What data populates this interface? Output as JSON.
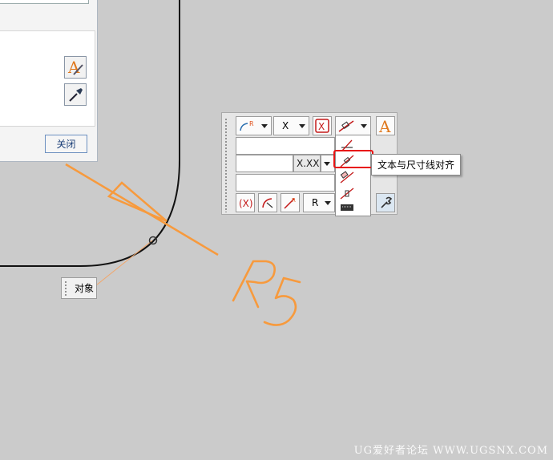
{
  "dialog": {
    "close_label": "关闭"
  },
  "toolbar": {
    "leader_dropdown_label": "",
    "axis_dropdown_value": "X",
    "format_field_value": "X.XX",
    "radius_dropdown_value": "R",
    "dimension_value": ""
  },
  "menu": {
    "items": [
      "leader-horizontal",
      "text-aligned-with-dimension-line",
      "text-above-dimension-line",
      "text-perpendicular",
      "keyboard-entry"
    ]
  },
  "tooltip": {
    "text": "文本与尺寸线对齐"
  },
  "object_label": {
    "text": "对象"
  },
  "dimension_text": "R5",
  "watermark": "UG爱好者论坛 WWW.UGSNX.COM",
  "colors": {
    "dimension": "#f79a3d",
    "highlight": "#e81414",
    "accent_blue": "#1a3e77"
  }
}
